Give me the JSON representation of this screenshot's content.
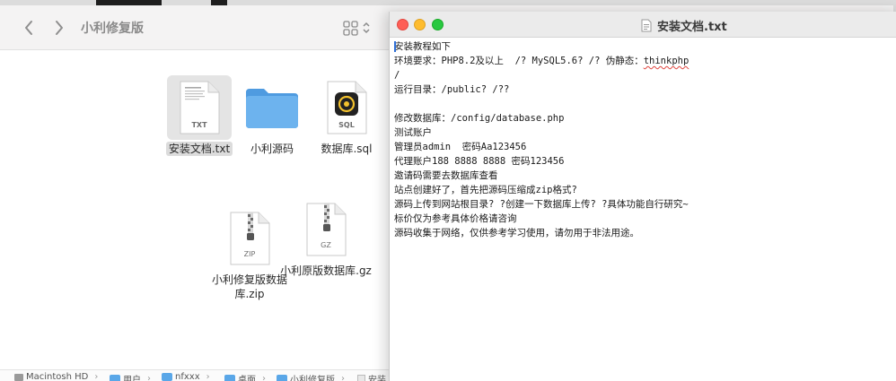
{
  "finder": {
    "title": "小利修复版",
    "files": [
      {
        "name": "安装文档.txt",
        "badge": "TXT",
        "kind": "txt",
        "selected": true
      },
      {
        "name": "小利源码",
        "badge": "",
        "kind": "folder",
        "selected": false
      },
      {
        "name": "数据库.sql",
        "badge": "SQL",
        "kind": "sql",
        "selected": false
      },
      {
        "name": "小利修复版数据库.zip",
        "badge": "ZIP",
        "kind": "zip",
        "selected": false
      },
      {
        "name": "小利原版数据库.gz",
        "badge": "GZ",
        "kind": "gz",
        "selected": false
      }
    ],
    "pathbar": [
      "Macintosh HD",
      "用户",
      "nfxxx",
      "桌面",
      "小利修复版",
      "安装"
    ]
  },
  "textedit": {
    "title": "安装文档.txt",
    "lines": [
      "安装教程如下",
      "环境要求：PHP8.2及以上  /? MySQL5.6? /? 伪静态：thinkphp",
      "/",
      "运行目录：/public? /??",
      "",
      "修改数据库：/config/database.php",
      "测试账户",
      "管理员admin  密码Aa123456",
      "代理账户188 8888 8888 密码123456",
      "邀请码需要去数据库查看",
      "站点创建好了，首先把源码压缩成zip格式?",
      "源码上传到网站根目录? ?创建一下数据库上传? ?具体功能自行研究~",
      "标价仅为参考具体价格请咨询",
      "源码收集于网络，仅供参考学习使用，请勿用于非法用途。"
    ]
  },
  "colors": {
    "folder_blue": "#5aa7e8",
    "close_red": "#fe5f57",
    "minimize_yellow": "#febc2e",
    "zoom_green": "#28c840",
    "caret_blue": "#2f6fd6"
  }
}
